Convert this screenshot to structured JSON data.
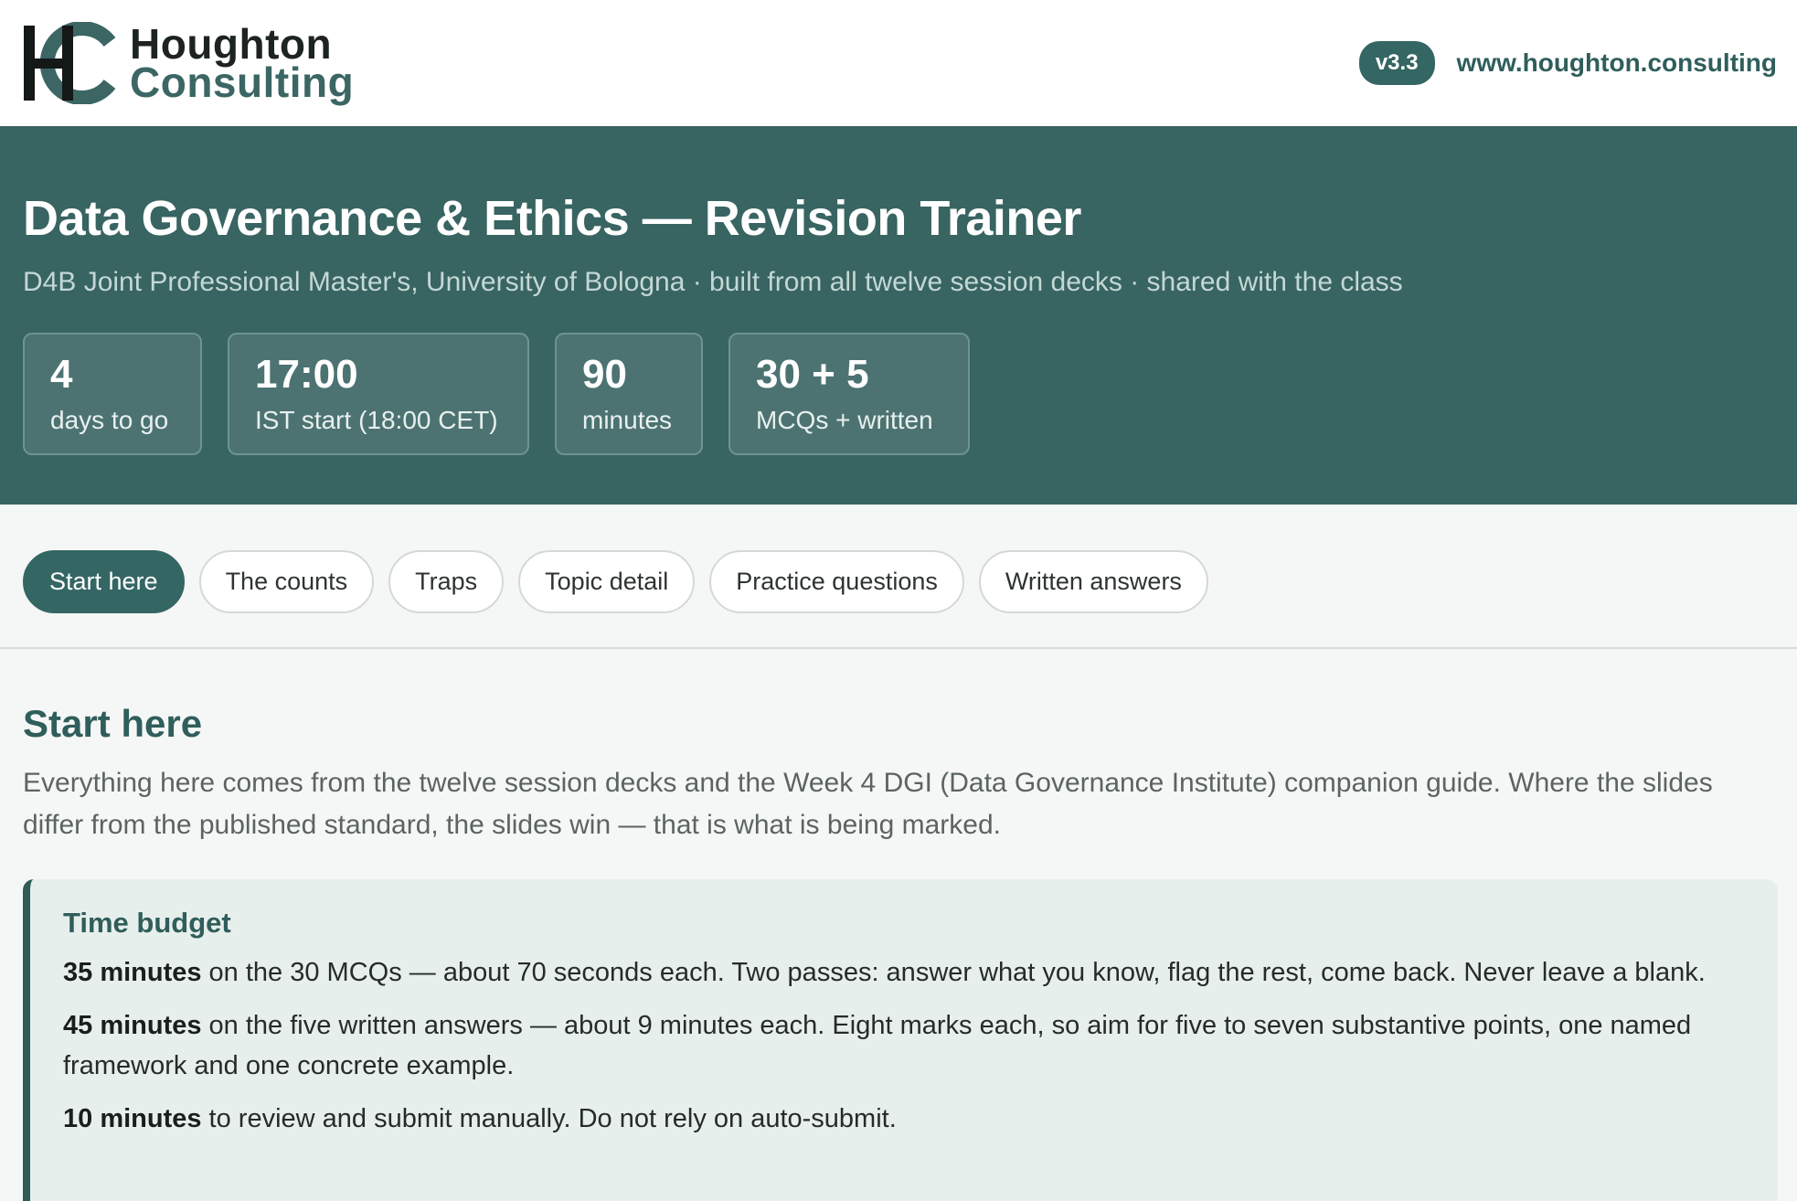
{
  "header": {
    "logo_line1": "Houghton",
    "logo_line2": "Consulting",
    "version": "v3.3",
    "site_link": "www.houghton.consulting"
  },
  "hero": {
    "title": "Data Governance & Ethics — Revision Trainer",
    "subtitle": "D4B Joint Professional Master's, University of Bologna · built from all twelve session decks · shared with the class",
    "stats": [
      {
        "value": "4",
        "label": "days to go"
      },
      {
        "value": "17:00",
        "label": "IST start (18:00 CET)"
      },
      {
        "value": "90",
        "label": "minutes"
      },
      {
        "value": "30 + 5",
        "label": "MCQs + written"
      }
    ]
  },
  "tabs": [
    {
      "label": "Start here",
      "active": true
    },
    {
      "label": "The counts",
      "active": false
    },
    {
      "label": "Traps",
      "active": false
    },
    {
      "label": "Topic detail",
      "active": false
    },
    {
      "label": "Practice questions",
      "active": false
    },
    {
      "label": "Written answers",
      "active": false
    }
  ],
  "main": {
    "section_title": "Start here",
    "intro": "Everything here comes from the twelve session decks and the Week 4 DGI (Data Governance Institute) companion guide. Where the slides differ from the published standard, the slides win — that is what is being marked.",
    "callout": {
      "title": "Time budget",
      "items": [
        {
          "bold": "35 minutes",
          "text": " on the 30 MCQs — about 70 seconds each. Two passes: answer what you know, flag the rest, come back. Never leave a blank."
        },
        {
          "bold": "45 minutes",
          "text": " on the five written answers — about 9 minutes each. Eight marks each, so aim for five to seven substantive points, one named framework and one concrete example."
        },
        {
          "bold": "10 minutes",
          "text": " to review and submit manually. Do not rely on auto-submit."
        }
      ]
    }
  },
  "colors": {
    "brand": "#386462",
    "accent_dark": "#2f5e5b",
    "callout_bg": "#e7efed"
  }
}
